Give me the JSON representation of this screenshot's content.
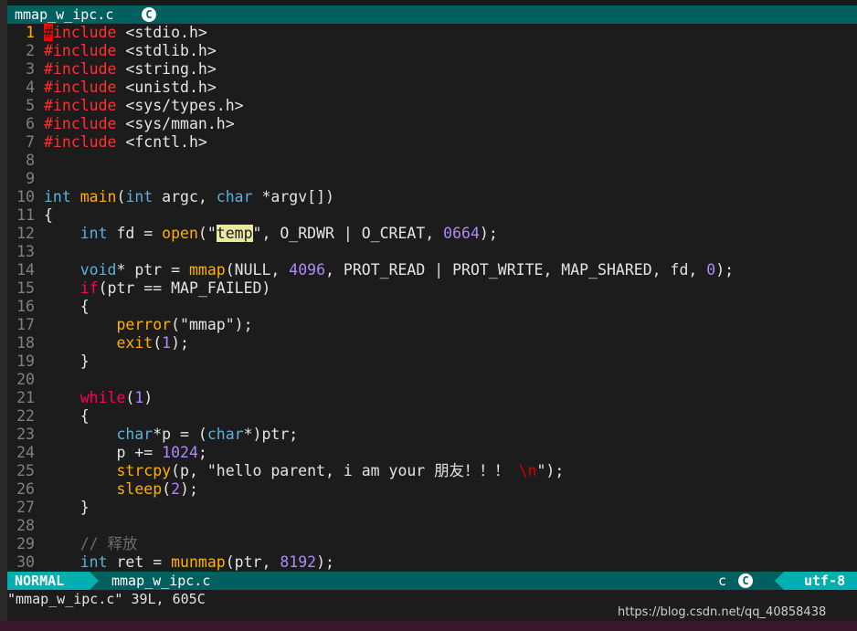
{
  "tab": {
    "filename": "mmap_w_ipc.c",
    "icon": "c-language-icon"
  },
  "lines": [
    {
      "n": "1",
      "cur": true,
      "segs": [
        {
          "t": "#",
          "c": "cursor"
        },
        {
          "t": "include",
          "c": "pp"
        },
        {
          "t": " <stdio.h>",
          "c": ""
        }
      ]
    },
    {
      "n": "2",
      "segs": [
        {
          "t": "#include",
          "c": "pp"
        },
        {
          "t": " <stdlib.h>",
          "c": ""
        }
      ]
    },
    {
      "n": "3",
      "segs": [
        {
          "t": "#include",
          "c": "pp"
        },
        {
          "t": " <string.h>",
          "c": ""
        }
      ]
    },
    {
      "n": "4",
      "segs": [
        {
          "t": "#include",
          "c": "pp"
        },
        {
          "t": " <unistd.h>",
          "c": ""
        }
      ]
    },
    {
      "n": "5",
      "segs": [
        {
          "t": "#include",
          "c": "pp"
        },
        {
          "t": " <sys/types.h>",
          "c": ""
        }
      ]
    },
    {
      "n": "6",
      "segs": [
        {
          "t": "#include",
          "c": "pp"
        },
        {
          "t": " <sys/mman.h>",
          "c": ""
        }
      ]
    },
    {
      "n": "7",
      "segs": [
        {
          "t": "#include",
          "c": "pp"
        },
        {
          "t": " <fcntl.h>",
          "c": ""
        }
      ]
    },
    {
      "n": "8",
      "segs": []
    },
    {
      "n": "9",
      "segs": []
    },
    {
      "n": "10",
      "segs": [
        {
          "t": "int",
          "c": "kw"
        },
        {
          "t": " ",
          "c": ""
        },
        {
          "t": "main",
          "c": "fn"
        },
        {
          "t": "(",
          "c": ""
        },
        {
          "t": "int",
          "c": "kw"
        },
        {
          "t": " argc, ",
          "c": ""
        },
        {
          "t": "char",
          "c": "kw"
        },
        {
          "t": " *argv[])",
          "c": ""
        }
      ]
    },
    {
      "n": "11",
      "segs": [
        {
          "t": "{",
          "c": ""
        }
      ]
    },
    {
      "n": "12",
      "segs": [
        {
          "t": "    ",
          "c": ""
        },
        {
          "t": "int",
          "c": "kw"
        },
        {
          "t": " fd = ",
          "c": ""
        },
        {
          "t": "open",
          "c": "fn"
        },
        {
          "t": "(\"",
          "c": ""
        },
        {
          "t": "temp",
          "c": "hl"
        },
        {
          "t": "\", O_RDWR | O_CREAT, ",
          "c": ""
        },
        {
          "t": "0664",
          "c": "num"
        },
        {
          "t": ");",
          "c": ""
        }
      ]
    },
    {
      "n": "13",
      "segs": []
    },
    {
      "n": "14",
      "segs": [
        {
          "t": "    ",
          "c": ""
        },
        {
          "t": "void",
          "c": "kw"
        },
        {
          "t": "* ptr = ",
          "c": ""
        },
        {
          "t": "mmap",
          "c": "fn"
        },
        {
          "t": "(NULL, ",
          "c": ""
        },
        {
          "t": "4096",
          "c": "num"
        },
        {
          "t": ", PROT_READ | PROT_WRITE, MAP_SHARED, fd, ",
          "c": ""
        },
        {
          "t": "0",
          "c": "num"
        },
        {
          "t": ");",
          "c": ""
        }
      ]
    },
    {
      "n": "15",
      "segs": [
        {
          "t": "    ",
          "c": ""
        },
        {
          "t": "if",
          "c": "ctl"
        },
        {
          "t": "(ptr == MAP_FAILED)",
          "c": ""
        }
      ]
    },
    {
      "n": "16",
      "segs": [
        {
          "t": "    {",
          "c": ""
        }
      ]
    },
    {
      "n": "17",
      "segs": [
        {
          "t": "        ",
          "c": ""
        },
        {
          "t": "perror",
          "c": "fn"
        },
        {
          "t": "(\"mmap\");",
          "c": ""
        }
      ]
    },
    {
      "n": "18",
      "segs": [
        {
          "t": "        ",
          "c": ""
        },
        {
          "t": "exit",
          "c": "fn"
        },
        {
          "t": "(",
          "c": ""
        },
        {
          "t": "1",
          "c": "num"
        },
        {
          "t": ");",
          "c": ""
        }
      ]
    },
    {
      "n": "19",
      "segs": [
        {
          "t": "    }",
          "c": ""
        }
      ]
    },
    {
      "n": "20",
      "segs": []
    },
    {
      "n": "21",
      "segs": [
        {
          "t": "    ",
          "c": ""
        },
        {
          "t": "while",
          "c": "ctl"
        },
        {
          "t": "(",
          "c": ""
        },
        {
          "t": "1",
          "c": "num"
        },
        {
          "t": ")",
          "c": ""
        }
      ]
    },
    {
      "n": "22",
      "segs": [
        {
          "t": "    {",
          "c": ""
        }
      ]
    },
    {
      "n": "23",
      "segs": [
        {
          "t": "        ",
          "c": ""
        },
        {
          "t": "char",
          "c": "kw"
        },
        {
          "t": "*p = (",
          "c": ""
        },
        {
          "t": "char",
          "c": "kw"
        },
        {
          "t": "*)ptr;",
          "c": ""
        }
      ]
    },
    {
      "n": "24",
      "segs": [
        {
          "t": "        p += ",
          "c": ""
        },
        {
          "t": "1024",
          "c": "num"
        },
        {
          "t": ";",
          "c": ""
        }
      ]
    },
    {
      "n": "25",
      "segs": [
        {
          "t": "        ",
          "c": ""
        },
        {
          "t": "strcpy",
          "c": "fn"
        },
        {
          "t": "(p, \"hello parent, i am your 朋友！！！ ",
          "c": ""
        },
        {
          "t": "\\n",
          "c": "esc"
        },
        {
          "t": "\");",
          "c": ""
        }
      ]
    },
    {
      "n": "26",
      "segs": [
        {
          "t": "        ",
          "c": ""
        },
        {
          "t": "sleep",
          "c": "fn"
        },
        {
          "t": "(",
          "c": ""
        },
        {
          "t": "2",
          "c": "num"
        },
        {
          "t": ");",
          "c": ""
        }
      ]
    },
    {
      "n": "27",
      "segs": [
        {
          "t": "    }",
          "c": ""
        }
      ]
    },
    {
      "n": "28",
      "segs": []
    },
    {
      "n": "29",
      "segs": [
        {
          "t": "    ",
          "c": ""
        },
        {
          "t": "// 释放",
          "c": "cmt"
        }
      ]
    },
    {
      "n": "30",
      "segs": [
        {
          "t": "    ",
          "c": ""
        },
        {
          "t": "int",
          "c": "kw"
        },
        {
          "t": " ret = ",
          "c": ""
        },
        {
          "t": "munmap",
          "c": "fn"
        },
        {
          "t": "(ptr, ",
          "c": ""
        },
        {
          "t": "8192",
          "c": "num"
        },
        {
          "t": ");",
          "c": ""
        }
      ]
    }
  ],
  "status": {
    "mode": "NORMAL",
    "filename": "mmap_w_ipc.c",
    "filetype": "c",
    "filetype_icon": "c-language-icon",
    "encoding": "utf-8"
  },
  "cmdline": "\"mmap_w_ipc.c\" 39L, 605C",
  "watermark": "https://blog.csdn.net/qq_40858438",
  "colors": {
    "accent_teal": "#005f5f",
    "mode_teal": "#00afaf",
    "preprocessor": "#ff3030",
    "keyword": "#5fafd7",
    "function": "#ffaf00",
    "number": "#af87ff",
    "control": "#ff005f",
    "background": "#1c1c1c"
  }
}
